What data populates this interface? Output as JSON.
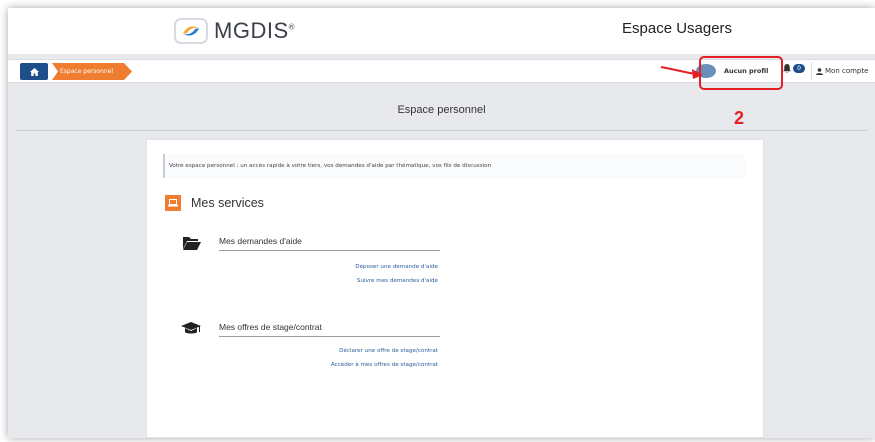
{
  "header": {
    "logo_text": "MGDIS",
    "logo_reg": "®",
    "title": "Espace Usagers"
  },
  "navbar": {
    "home_icon": "home-icon",
    "breadcrumb": "Espace personnel",
    "profile_label": "Aucun profil",
    "notifications_count": "0",
    "account_label": "Mon compte"
  },
  "annotation": {
    "step_number": "2",
    "color": "#e31e24"
  },
  "page": {
    "title": "Espace personnel",
    "intro": "Votre espace personnel : un accès rapide à votre tiers, vos demandes d'aide par thématique, vos fils de discussion",
    "services_title": "Mes services",
    "sections": [
      {
        "title": "Mes demandes d'aide",
        "icon": "folder-icon",
        "links": [
          "Déposer une demande d'aide",
          "Suivre mes demandes d'aide"
        ]
      },
      {
        "title": "Mes offres de stage/contrat",
        "icon": "graduation-cap-icon",
        "links": [
          "Déclarer une offre de stage/contrat",
          "Accéder à mes offres de stage/contrat"
        ]
      }
    ]
  },
  "colors": {
    "primary": "#1e4f8b",
    "accent": "#ee7d30",
    "link": "#2a5d9a"
  }
}
